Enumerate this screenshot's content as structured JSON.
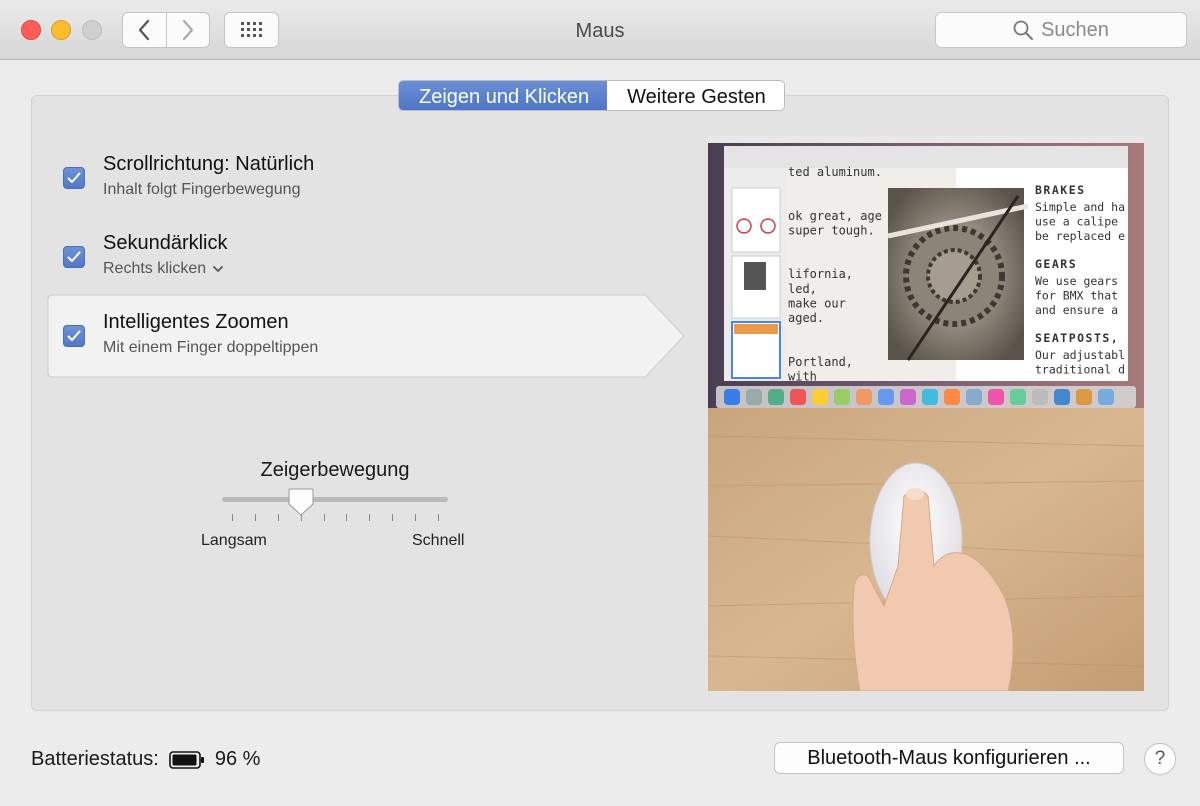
{
  "window": {
    "title": "Maus"
  },
  "toolbar": {
    "back_icon": "chevron-left-icon",
    "forward_icon": "chevron-right-icon",
    "grid_icon": "show-all-grid-icon",
    "search_placeholder": "Suchen"
  },
  "tabs": [
    {
      "label": "Zeigen und Klicken",
      "active": true
    },
    {
      "label": "Weitere Gesten",
      "active": false
    }
  ],
  "options": [
    {
      "title": "Scrollrichtung: Natürlich",
      "subtitle": "Inhalt folgt Fingerbewegung",
      "checked": true
    },
    {
      "title": "Sekundärklick",
      "subtitle": "Rechts klicken",
      "checked": true,
      "dropdown": true
    },
    {
      "title": "Intelligentes Zoomen",
      "subtitle": "Mit einem Finger doppeltippen",
      "checked": true,
      "selected": true
    }
  ],
  "tracking": {
    "title": "Zeigerbewegung",
    "min_label": "Langsam",
    "max_label": "Schnell",
    "value_fraction": 0.35,
    "tick_count": 10
  },
  "preview": {
    "headings": [
      "BRAKES",
      "GEARS",
      "SEATPOSTS,"
    ],
    "body_lines": [
      [
        "Simple and ha",
        "use a calipe",
        "be replaced e"
      ],
      [
        "We use gears",
        "for BMX that",
        "and ensure a"
      ],
      [
        "Our adjustabl",
        "traditional d"
      ]
    ],
    "left_lines": [
      "ted aluminum.",
      "",
      "",
      "ok great, age",
      "super tough.",
      "",
      "",
      "lifornia,",
      "led,",
      "make our",
      "aged.",
      "",
      "",
      "Portland,",
      "with"
    ]
  },
  "footer": {
    "battery_label": "Batteriestatus:",
    "battery_value": "96 %",
    "battery_level": 0.96,
    "bluetooth_button": "Bluetooth-Maus konfigurieren ...",
    "help_label": "?"
  },
  "colors": {
    "accent": "#5a7fcc",
    "close": "#fc5e57",
    "minimize": "#fdbc2e"
  }
}
